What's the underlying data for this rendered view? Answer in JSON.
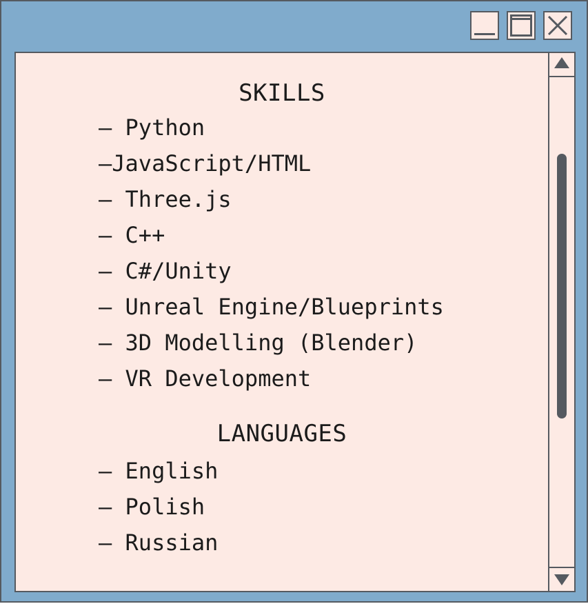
{
  "window": {
    "controls": {
      "minimize_icon": "minimize-icon",
      "maximize_icon": "maximize-icon",
      "close_icon": "close-icon"
    },
    "colors": {
      "frame": "#80abcc",
      "content_bg": "#fdeae4",
      "border": "#555a60",
      "text": "#1b1b1b"
    }
  },
  "skills": {
    "heading": "SKILLS",
    "items": [
      "– Python",
      "–JavaScript/HTML",
      "– Three.js",
      "– C++",
      "– C#/Unity",
      "– Unreal Engine/Blueprints",
      "– 3D Modelling (Blender)",
      "– VR Development"
    ]
  },
  "languages": {
    "heading": "LANGUAGES",
    "items": [
      "– English",
      "– Polish",
      "– Russian"
    ]
  },
  "scrollbar": {
    "up_icon": "arrow-up-icon",
    "down_icon": "arrow-down-icon"
  }
}
